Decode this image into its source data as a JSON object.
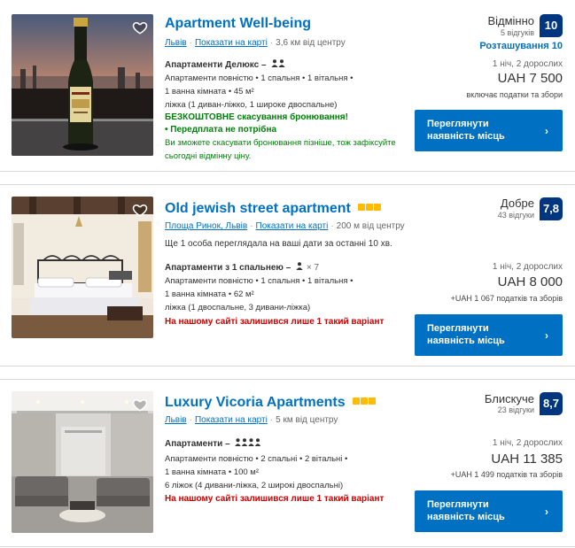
{
  "listings": [
    {
      "title": "Apartment Well-being",
      "stars": 0,
      "district": "Львів",
      "map_link": "Показати на карті",
      "distance": "3,6 км від центру",
      "score_word": "Відмінно",
      "reviews": "5 відгуків",
      "score": "10",
      "location_score": "Розташування 10",
      "room": "Апартаменти Делюкс –",
      "occupancy": "",
      "detail_1": "Апартаменти повністю • 1 спальня • 1 вітальня •",
      "detail_2": "1 ванна кімната • 45 м²",
      "detail_3": "ліжка (1 диван-ліжко, 1 широке двоспальне)",
      "free_cancel": "БЕЗКОШТОВНЕ скасування бронювання!",
      "no_prepay": "• Передплата не потрібна",
      "cancel_note_1": "Ви зможете скасувати бронювання пізніше, тож зафіксуйте",
      "cancel_note_2": "сьогодні відмінну ціну.",
      "nights": "1 ніч, 2 дорослих",
      "price": "UAH 7 500",
      "taxes": "включає податки та збори",
      "cta": [
        "Переглянути",
        "наявність місць"
      ]
    },
    {
      "title": "Old jewish street apartment",
      "stars": 3,
      "district": "Площа Ринок, Львів",
      "map_link": "Показати на карті",
      "distance": "200 м від центру",
      "score_word": "Добре",
      "reviews": "43 відгуки",
      "score": "7,8",
      "viewers": "Ще 1 особа переглядала на ваші дати за останні 10 хв.",
      "room": "Апартаменти з 1 спальнею –",
      "occupancy": "× 7",
      "detail_1": "Апартаменти повністю • 1 спальня • 1 вітальня •",
      "detail_2": "1 ванна кімната • 62 м²",
      "detail_3": "ліжка (1 двоспальне, 3 дивани-ліжка)",
      "availability": "На нашому сайті залишився лише 1 такий варіант",
      "nights": "1 ніч, 2 дорослих",
      "price": "UAH 8 000",
      "taxes": "+UAH 1 067 податків та зборів",
      "cta": [
        "Переглянути",
        "наявність місць"
      ]
    },
    {
      "title": "Luxury Vicoria Apartments",
      "stars": 3,
      "district": "Львів",
      "map_link": "Показати на карті",
      "distance": "5 км від центру",
      "score_word": "Блискуче",
      "reviews": "23 відгуки",
      "score": "8,7",
      "room": "Апартаменти –",
      "occupancy": "",
      "detail_1": "Апартаменти повністю • 2 спальні • 2 вітальні •",
      "detail_2": "1 ванна кімната • 100 м²",
      "detail_3": "6 ліжок (4 дивани-ліжка, 2 широкі двоспальні)",
      "availability": "На нашому сайті залишився лише 1 такий варіант",
      "nights": "1 ніч, 2 дорослих",
      "price": "UAH 11 385",
      "taxes": "+UAH 1 499 податків та зборів",
      "cta": [
        "Переглянути",
        "наявність місць"
      ]
    }
  ],
  "icons": {
    "favorite": "heart-icon",
    "occupancy": "person-icon",
    "cta_arrow": "chevron-right-icon",
    "rating_star": "star-icon"
  },
  "colors": {
    "link": "#0071c2",
    "score_box": "#003580",
    "star": "#febb02",
    "green": "#008009",
    "urgent": "#cc0000"
  }
}
